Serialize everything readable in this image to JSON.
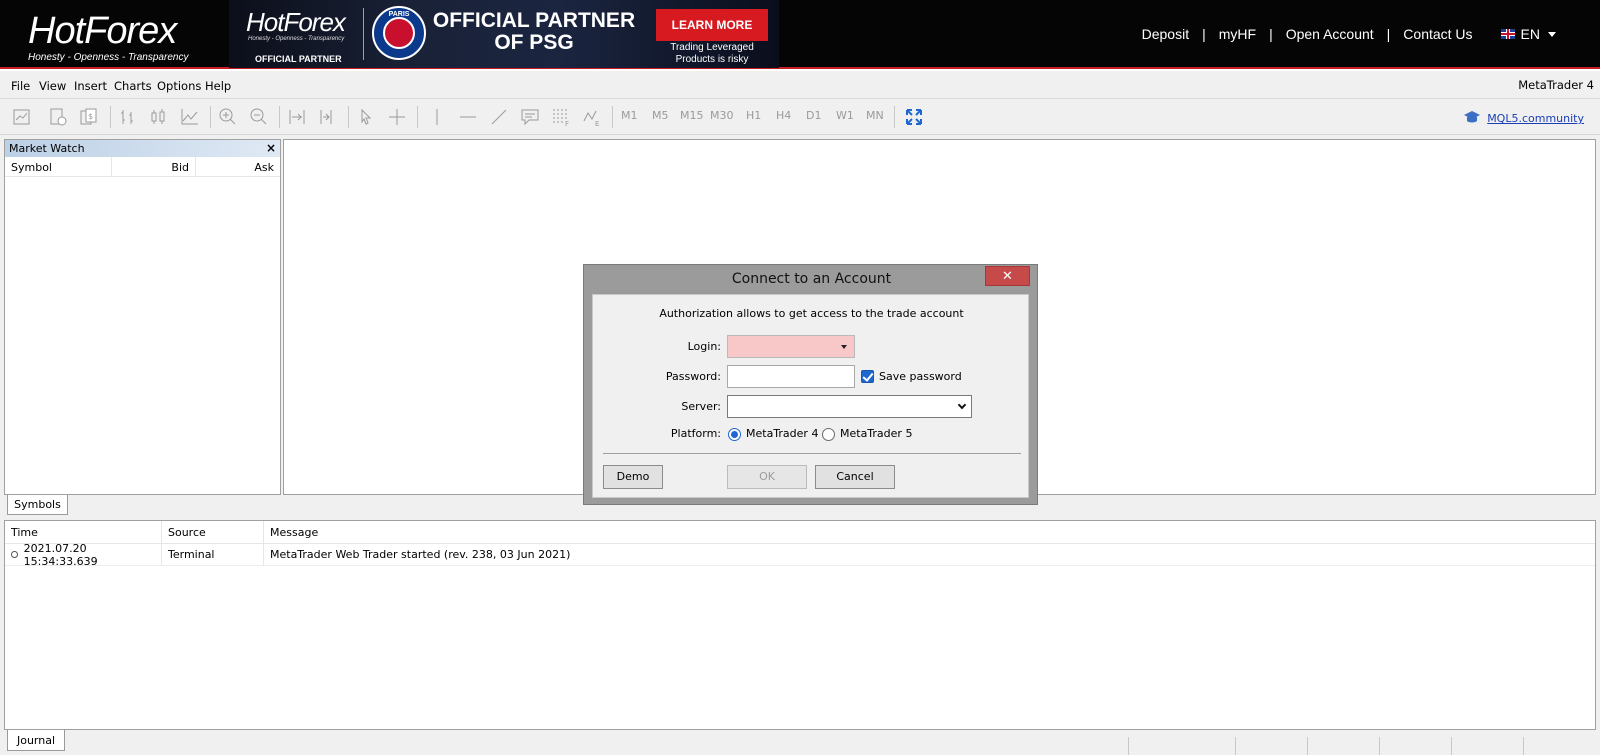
{
  "header": {
    "brand": {
      "name_hot": "Hot",
      "name_forex": "Forex",
      "tagline": "Honesty - Openness - Transparency"
    },
    "banner": {
      "logo": "HotForex",
      "tagline": "Honesty - Openness - Transparency",
      "partner_label": "OFFICIAL PARTNER",
      "club_badge": "PARIS",
      "headline": "OFFICIAL PARTNER OF PSG",
      "cta": "LEARN MORE",
      "risk_note": "Trading Leveraged Products is risky"
    },
    "nav": {
      "deposit": "Deposit",
      "myhf": "myHF",
      "open_account": "Open Account",
      "contact_us": "Contact Us",
      "separator": "|",
      "language": "EN"
    }
  },
  "menubar": {
    "items": [
      "File",
      "View",
      "Insert",
      "Charts",
      "Options",
      "Help"
    ],
    "app_title": "MetaTrader 4"
  },
  "toolbar": {
    "timeframes": [
      "M1",
      "M5",
      "M15",
      "M30",
      "H1",
      "H4",
      "D1",
      "W1",
      "MN"
    ],
    "community_link": "MQL5.community"
  },
  "market_watch": {
    "title": "Market Watch",
    "close": "×",
    "columns": [
      "Symbol",
      "Bid",
      "Ask"
    ],
    "tab": "Symbols"
  },
  "journal": {
    "columns": [
      "Time",
      "Source",
      "Message"
    ],
    "rows": [
      {
        "time": "2021.07.20 15:34:33.639",
        "source": "Terminal",
        "message": "MetaTrader Web Trader started (rev. 238, 03 Jun 2021)"
      }
    ],
    "tab": "Journal"
  },
  "dialog": {
    "title": "Connect to an Account",
    "close": "✕",
    "info": "Authorization allows to get access to the trade account",
    "login_label": "Login:",
    "login_value": "",
    "password_label": "Password:",
    "password_value": "",
    "save_password_label": "Save password",
    "save_password_checked": true,
    "server_label": "Server:",
    "server_value": "",
    "platform_label": "Platform:",
    "platform_options": [
      "MetaTrader 4",
      "MetaTrader 5"
    ],
    "platform_selected": "MetaTrader 4",
    "buttons": {
      "demo": "Demo",
      "ok": "OK",
      "cancel": "Cancel"
    }
  },
  "colors": {
    "accent_red": "#d71920",
    "dialog_close": "#c74a4a",
    "link_blue": "#1a3fb5",
    "login_invalid_bg": "#f8c8c8"
  }
}
